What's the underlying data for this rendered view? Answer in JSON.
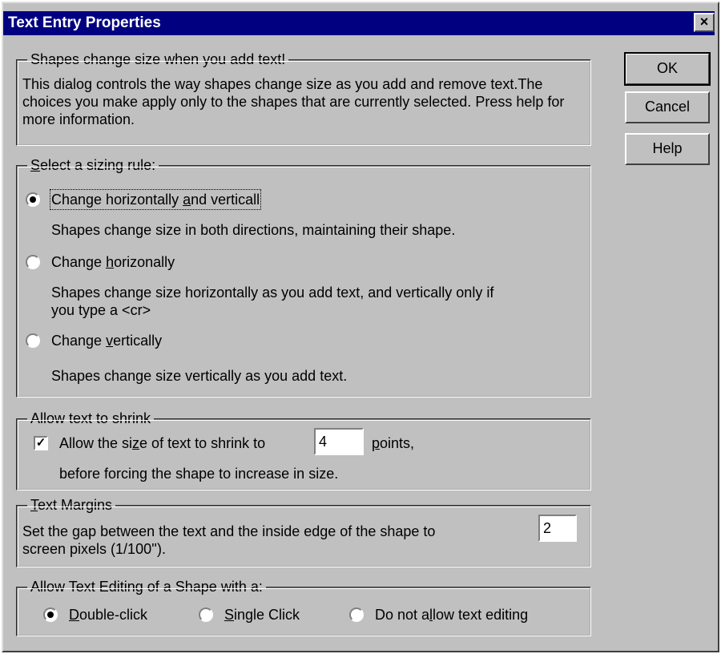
{
  "window": {
    "title": "Text Entry Properties",
    "close_glyph": "×"
  },
  "buttons": {
    "ok": "OK",
    "cancel": "Cancel",
    "help": "Help"
  },
  "intro": {
    "legend": "Shapes change size when you add text!",
    "description": "This dialog controls the way shapes change size as you add and remove text.The choices you make apply only to the shapes that are currently selected. Press help for more information."
  },
  "sizing": {
    "legend_prefix": "",
    "legend_mnemonic": "S",
    "legend_rest": "elect a sizing rule:",
    "options": [
      {
        "label_prefix": "Change horizontally ",
        "label_mnemonic": "a",
        "label_rest": "nd verticall",
        "description": "Shapes change size in both directions, maintaining their shape.",
        "checked": true
      },
      {
        "label_prefix": "Change ",
        "label_mnemonic": "h",
        "label_rest": "orizonally",
        "description_line1": "Shapes change size horizontally as you add text, and vertically only if",
        "description_line2": "you type a <cr>",
        "checked": false
      },
      {
        "label_prefix": "Change ",
        "label_mnemonic": "v",
        "label_rest": "ertically",
        "description": "Shapes change size vertically as you add text.",
        "checked": false
      }
    ]
  },
  "shrink": {
    "legend": "Allow text to shrink",
    "checkbox_label_prefix": "Allow the si",
    "checkbox_label_mnemonic": "z",
    "checkbox_label_rest": "e of text to shrink to",
    "checked": true,
    "points_value": "4",
    "points_label_mnemonic": "p",
    "points_label_rest": "oints,",
    "note": "before forcing the shape to increase in size."
  },
  "margins": {
    "legend_mnemonic": "T",
    "legend_rest": "ext Margins",
    "line1": "Set the gap between the text and the inside edge of the shape to",
    "line2": "screen pixels (1/100'').",
    "value": "2"
  },
  "editing": {
    "legend": "Allow Text Editing of a Shape with a:",
    "options": [
      {
        "mnemonic": "D",
        "rest": "ouble-click",
        "checked": true
      },
      {
        "mnemonic": "S",
        "rest": "ingle Click",
        "checked": false
      },
      {
        "prefix": "Do not a",
        "mnemonic": "l",
        "rest": "low text editing",
        "checked": false
      }
    ]
  },
  "colors": {
    "face": "#c0c0c0",
    "titlebar": "#000080"
  }
}
